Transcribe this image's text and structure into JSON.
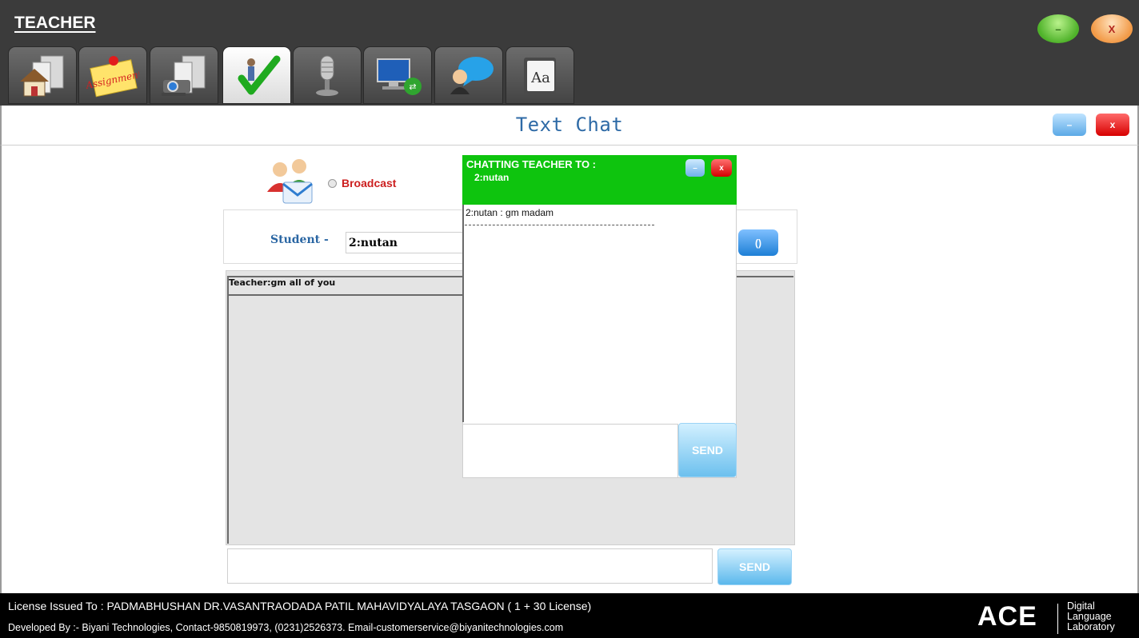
{
  "app": {
    "title": "TEACHER",
    "min_glyph": "–",
    "close_glyph": "X"
  },
  "toolbar": {
    "tabs": [
      {
        "icon": "home-icon"
      },
      {
        "icon": "assignment-note-icon",
        "label": "Assignment"
      },
      {
        "icon": "projector-icon"
      },
      {
        "icon": "checkmark-icon"
      },
      {
        "icon": "microphone-icon"
      },
      {
        "icon": "remote-desktop-icon"
      },
      {
        "icon": "chat-user-icon"
      },
      {
        "icon": "dictionary-icon",
        "label": "Aa"
      }
    ],
    "active_index": 3
  },
  "panel": {
    "title": "Text Chat",
    "min_glyph": "–",
    "close_glyph": "x"
  },
  "broadcast": {
    "label": "Broadcast"
  },
  "student": {
    "label": "Student -",
    "selected": "2:nutan",
    "refresh_glyph": "()"
  },
  "chat_log": {
    "lines": [
      "Teacher:gm all of you"
    ]
  },
  "send_label": "SEND",
  "popup": {
    "title_line1": "CHATTING TEACHER  TO :",
    "title_line2": "2:nutan",
    "min_glyph": "–",
    "close_glyph": "x",
    "messages": [
      "2:nutan : gm madam"
    ],
    "send_label": "SEND"
  },
  "footer": {
    "license": "License Issued To :   PADMABHUSHAN DR.VASANTRAODADA PATIL MAHAVIDYALAYA TASGAON ( 1 + 30 License)",
    "developer": "Developed By :- Biyani Technologies, Contact-9850819973, (0231)2526373. Email-customerservice@biyanitechnologies.com",
    "brand": "ACE",
    "brand_sub1": "Digital",
    "brand_sub2": "Language",
    "brand_sub3": "Laboratory"
  },
  "colors": {
    "header_bg": "#3b3b3b",
    "popup_header": "#0ec40e",
    "broadcast_red": "#cc1f1f",
    "title_blue": "#2e6aa6",
    "footer_bg": "#000000"
  }
}
